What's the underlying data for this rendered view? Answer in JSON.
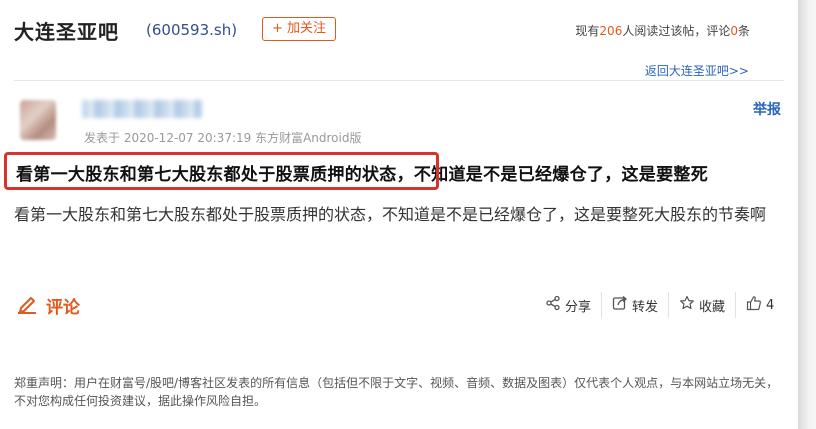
{
  "header": {
    "bar_name": "大连圣亚吧",
    "stock_code": "(600593.sh)",
    "follow_label": "+ 加关注",
    "stats_prefix": "现有",
    "readers": "206",
    "stats_mid": "人阅读过该帖，评论",
    "comments": "0",
    "stats_suffix": "条"
  },
  "nav": {
    "back_link": "返回大连圣亚吧>>"
  },
  "post": {
    "meta": "发表于 2020-12-07 20:37:19 东方财富Android版",
    "report_label": "举报",
    "title": "看第一大股东和第七大股东都处于股票质押的状态，不知道是不是已经爆仓了，这是要整死",
    "body": "看第一大股东和第七大股东都处于股票质押的状态，不知道是不是已经爆仓了，这是要整死大股东的节奏啊"
  },
  "footer": {
    "comment_label": "评论",
    "share_label": "分享",
    "forward_label": "转发",
    "favorite_label": "收藏",
    "like_count": "4"
  },
  "disclaimer": "郑重声明：用户在财富号/股吧/博客社区发表的所有信息（包括但不限于文字、视频、音频、数据及图表）仅代表个人观点，与本网站立场无关，不对您构成任何投资建议，据此操作风险自担。",
  "colors": {
    "accent": "#e05a1e",
    "link": "#2a65b8",
    "highlight": "#d7332e"
  },
  "icons": [
    "edit-icon",
    "share-icon",
    "forward-icon",
    "star-icon",
    "thumbs-up-icon"
  ]
}
